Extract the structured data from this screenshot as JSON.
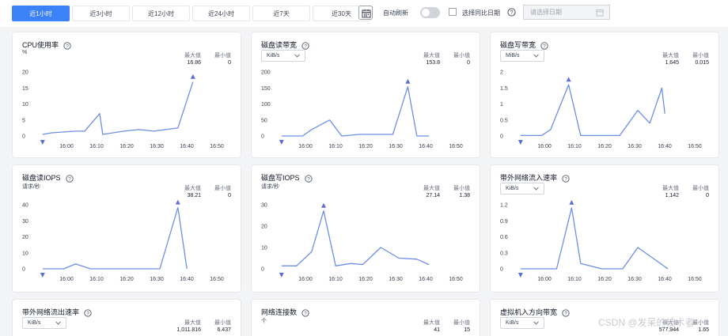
{
  "toolbar": {
    "tabs": [
      {
        "label": "近1小时",
        "active": true
      },
      {
        "label": "近3小时",
        "active": false
      },
      {
        "label": "近12小时",
        "active": false
      },
      {
        "label": "近24小时",
        "active": false
      },
      {
        "label": "近7天",
        "active": false
      },
      {
        "label": "近30天",
        "active": false
      }
    ],
    "auto_refresh_label": "自动刷新",
    "compare_label": "选择同比日期",
    "date_placeholder": "请选择日期"
  },
  "labels": {
    "max": "最大值",
    "min": "最小值"
  },
  "x_ticks": [
    "16:00",
    "16:10",
    "16:20",
    "16:30",
    "16:40",
    "16:50"
  ],
  "cards": [
    {
      "title": "CPU使用率",
      "unit": "%",
      "unit_select": false,
      "max": "16.86",
      "min": "0",
      "chart_data": {
        "type": "line",
        "title": "CPU使用率",
        "x": [
          "15:53",
          "15:56",
          "16:04",
          "16:07",
          "16:12",
          "16:13",
          "16:20",
          "16:25",
          "16:30",
          "16:38",
          "16:43"
        ],
        "y": [
          0.5,
          1,
          1.5,
          1.5,
          7,
          0.5,
          1.5,
          2,
          1.5,
          2.5,
          16.86
        ],
        "ylim": [
          0,
          20
        ],
        "yticks": [
          0,
          5,
          10,
          15,
          20
        ],
        "max": 16.86,
        "min": 0
      }
    },
    {
      "title": "磁盘读带宽",
      "unit": "KiB/s",
      "unit_select": true,
      "max": "153.8",
      "min": "0",
      "chart_data": {
        "type": "line",
        "title": "磁盘读带宽",
        "x": [
          "15:53",
          "16:00",
          "16:03",
          "16:09",
          "16:13",
          "16:19",
          "16:20",
          "16:25",
          "16:30",
          "16:35",
          "16:38",
          "16:42"
        ],
        "y": [
          0,
          0,
          20,
          50,
          0,
          5,
          5,
          5,
          5,
          153.8,
          0,
          0
        ],
        "ylim": [
          0,
          200
        ],
        "yticks": [
          0,
          50,
          100,
          150,
          200
        ],
        "max": 153.8,
        "min": 0
      }
    },
    {
      "title": "磁盘写带宽",
      "unit": "MiB/s",
      "unit_select": true,
      "max": "1.645",
      "min": "0.015",
      "chart_data": {
        "type": "line",
        "title": "磁盘写带宽",
        "x": [
          "15:53",
          "16:00",
          "16:03",
          "16:09",
          "16:13",
          "16:20",
          "16:26",
          "16:32",
          "16:36",
          "16:40",
          "16:41"
        ],
        "y": [
          0.015,
          0.015,
          0.2,
          1.6,
          0.015,
          0.015,
          0.015,
          0.8,
          0.4,
          1.5,
          0.7
        ],
        "ylim": [
          0,
          2
        ],
        "yticks": [
          0,
          0.5,
          1,
          1.5,
          2
        ],
        "max": 1.645,
        "min": 0.015
      }
    },
    {
      "title": "磁盘读IOPS",
      "unit": "请求/秒",
      "unit_select": false,
      "max": "38.21",
      "min": "0",
      "chart_data": {
        "type": "line",
        "title": "磁盘读IOPS",
        "x": [
          "15:53",
          "16:00",
          "16:04",
          "16:09",
          "16:15",
          "16:20",
          "16:25",
          "16:32",
          "16:38",
          "16:41"
        ],
        "y": [
          0,
          0,
          3,
          0,
          0,
          0,
          0,
          0,
          38.21,
          0
        ],
        "ylim": [
          0,
          40
        ],
        "yticks": [
          0,
          10,
          20,
          30,
          40
        ],
        "max": 38.21,
        "min": 0
      }
    },
    {
      "title": "磁盘写IOPS",
      "unit": "请求/秒",
      "unit_select": false,
      "max": "27.14",
      "min": "1.38",
      "chart_data": {
        "type": "line",
        "title": "磁盘写IOPS",
        "x": [
          "15:53",
          "15:58",
          "16:03",
          "16:07",
          "16:11",
          "16:16",
          "16:20",
          "16:26",
          "16:32",
          "16:38",
          "16:42"
        ],
        "y": [
          1.38,
          1.38,
          8,
          27.14,
          1.38,
          2.5,
          2,
          10,
          5,
          4.5,
          2
        ],
        "ylim": [
          0,
          30
        ],
        "yticks": [
          0,
          10,
          20,
          30
        ],
        "max": 27.14,
        "min": 1.38
      }
    },
    {
      "title": "带外网络流入速率",
      "unit": "KiB/s",
      "unit_select": true,
      "max": "1.142",
      "min": "0",
      "chart_data": {
        "type": "line",
        "title": "带外网络流入速率",
        "x": [
          "15:53",
          "16:00",
          "16:05",
          "16:10",
          "16:13",
          "16:20",
          "16:27",
          "16:32",
          "16:37",
          "16:42"
        ],
        "y": [
          0,
          0,
          0,
          1.142,
          0.1,
          0,
          0,
          0.4,
          0.2,
          0
        ],
        "ylim": [
          0,
          1.2
        ],
        "yticks": [
          0,
          0.3,
          0.6,
          0.9,
          1.2
        ],
        "max": 1.142,
        "min": 0
      }
    },
    {
      "title": "带外网络流出速率",
      "unit": "KiB/s",
      "unit_select": true,
      "max": "1,011.816",
      "min": "6.437"
    },
    {
      "title": "网络连接数",
      "unit": "个",
      "unit_select": false,
      "max": "41",
      "min": "15"
    },
    {
      "title": "虚拟机入方向带宽",
      "unit": "KiB/s",
      "unit_select": true,
      "max": "577.944",
      "min": "1.65"
    }
  ],
  "watermark": "CSDN @发呆的技术者",
  "colors": {
    "accent": "#3b82f6",
    "line": "#6b8ee6",
    "marker": "#5b6fd8"
  }
}
